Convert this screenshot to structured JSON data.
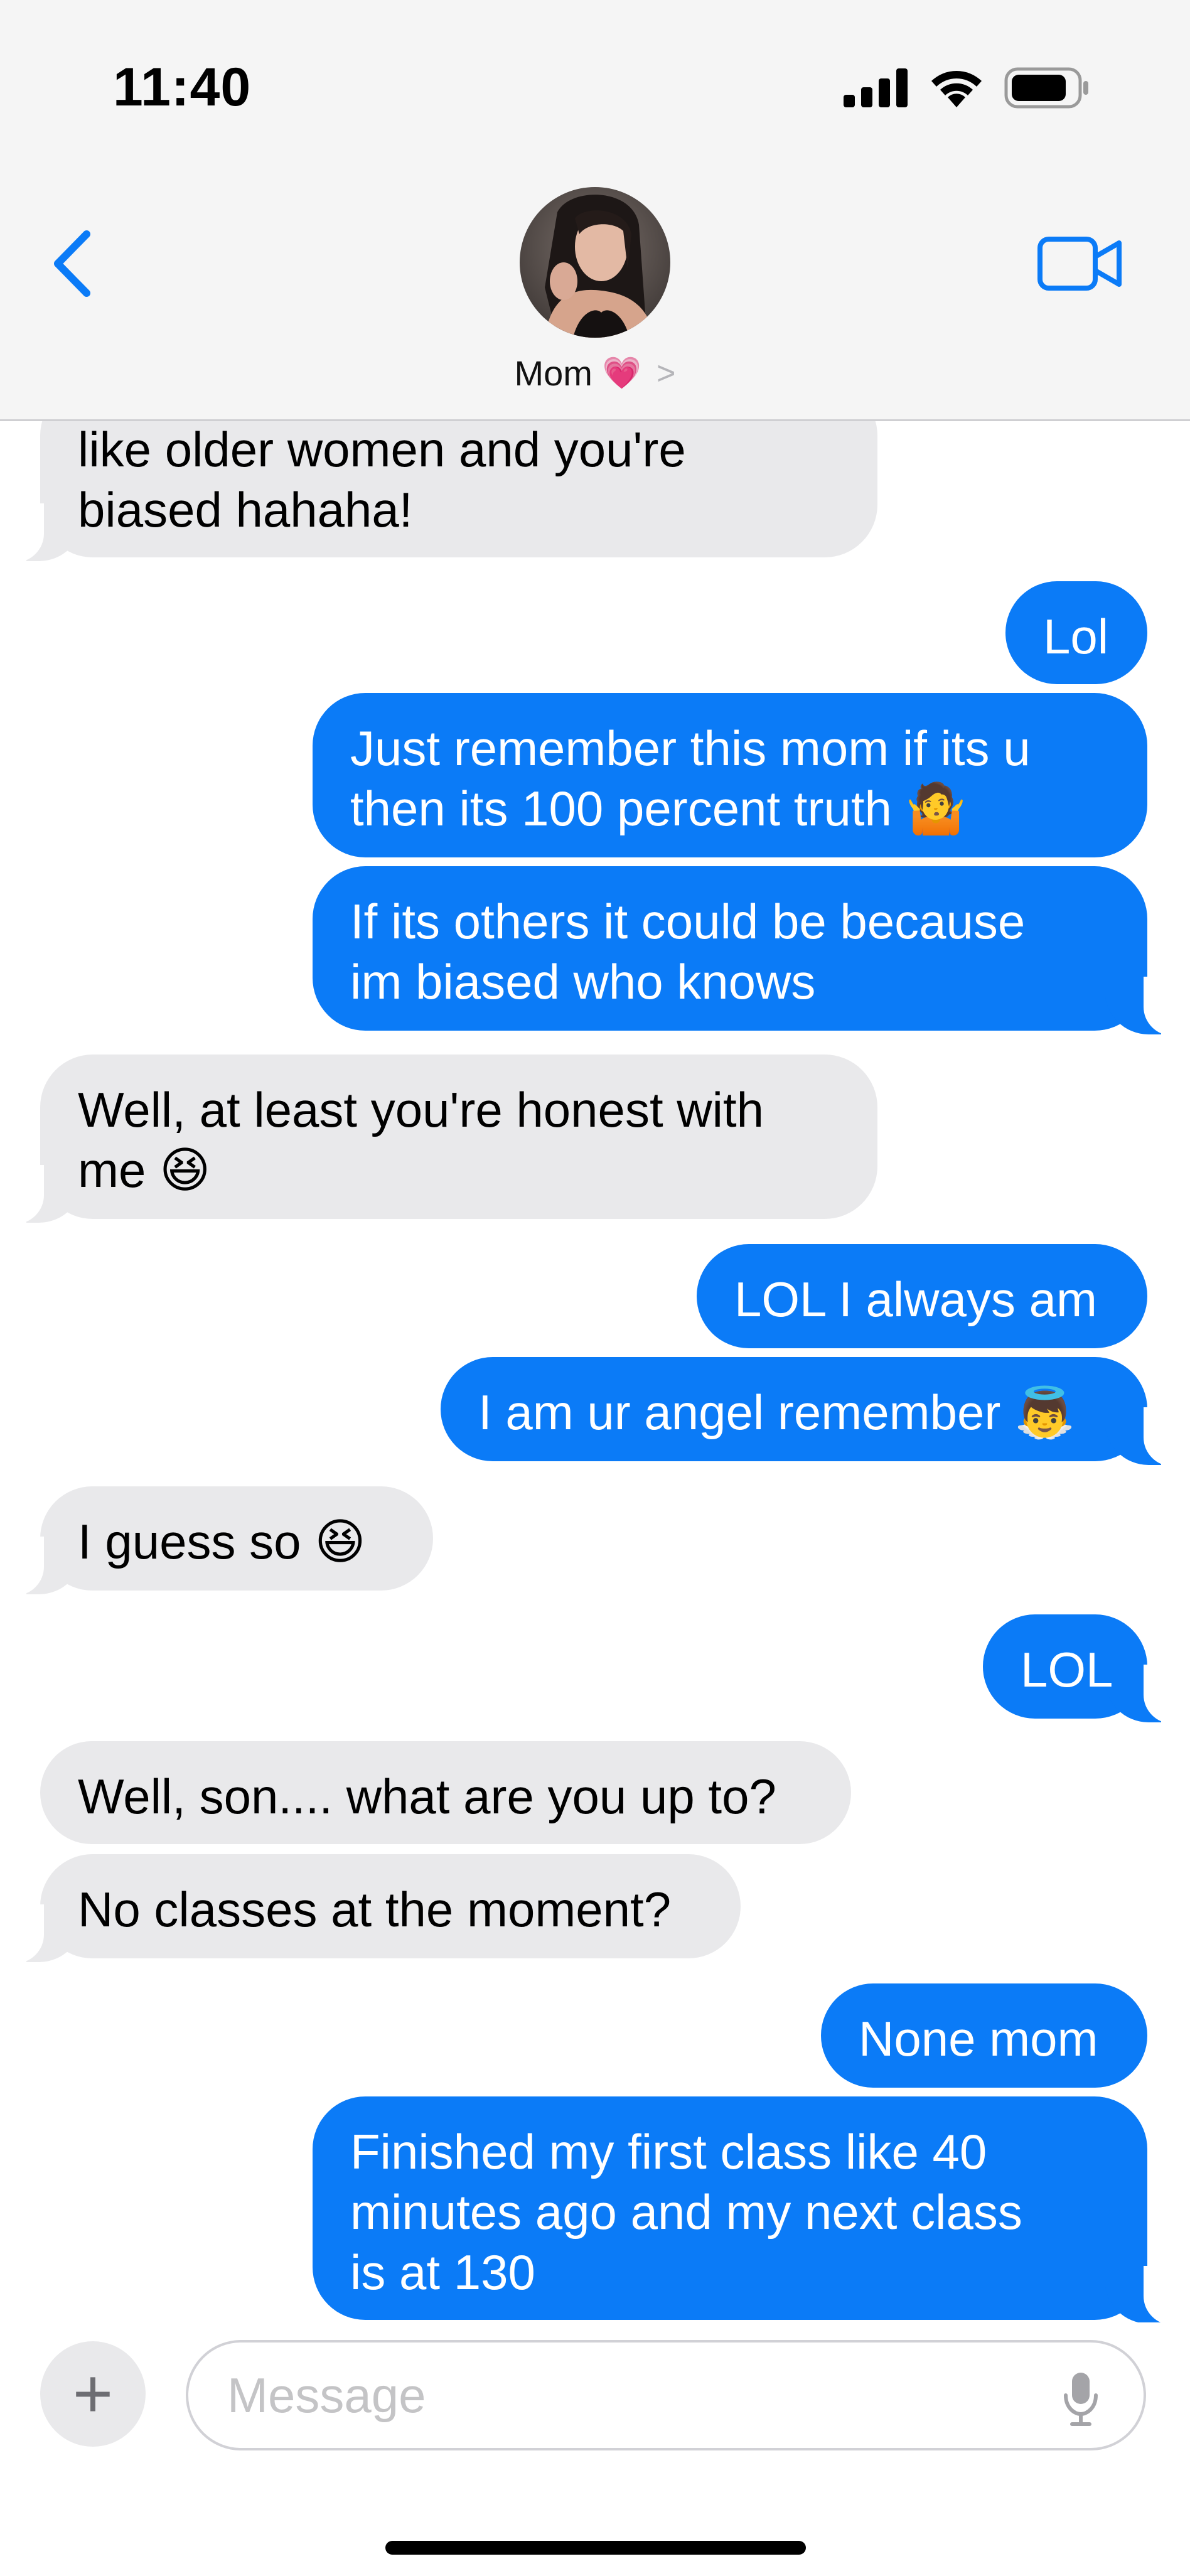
{
  "status_bar": {
    "time": "11:40"
  },
  "header": {
    "contact_name": "Mom",
    "contact_emoji": "💗",
    "chevron": ">",
    "back_icon": "chevron-left-icon",
    "video_icon": "video-camera-icon",
    "accent_color": "#0b7bf7"
  },
  "messages": [
    {
      "direction": "in",
      "text": "like older women and you're\nbiased hahaha!"
    },
    {
      "direction": "out",
      "text": "Lol"
    },
    {
      "direction": "out",
      "text": "Just remember this mom if its u\nthen its 100 percent truth 🤷"
    },
    {
      "direction": "out",
      "text": "If its others it could be because\nim biased who knows"
    },
    {
      "direction": "in",
      "text": "Well, at least you're honest with\nme 😆"
    },
    {
      "direction": "out",
      "text": "LOL I always am"
    },
    {
      "direction": "out",
      "text": "I am ur angel remember 👼"
    },
    {
      "direction": "in",
      "text": "I guess so 😆"
    },
    {
      "direction": "out",
      "text": "LOL"
    },
    {
      "direction": "in",
      "text": "Well, son.... what are you up to?"
    },
    {
      "direction": "in",
      "text": "No classes at the moment?"
    },
    {
      "direction": "out",
      "text": "None mom"
    },
    {
      "direction": "out",
      "text": "Finished my first class like 40\nminutes ago and my next class\nis at 130"
    }
  ],
  "composer": {
    "plus_label": "+",
    "placeholder": "Message",
    "mic_icon": "microphone-icon"
  },
  "colors": {
    "incoming_bubble": "#e9e9eb",
    "outgoing_bubble": "#0b7bf7",
    "header_bg": "#f5f5f5"
  }
}
